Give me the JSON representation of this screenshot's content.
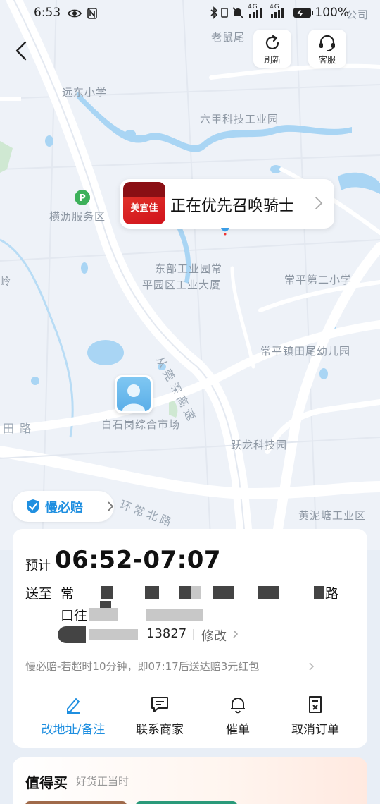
{
  "status_bar": {
    "time": "6:53",
    "battery": "100%",
    "network_1": "4G",
    "network_2": "4G"
  },
  "top_controls": {
    "refresh_label": "刷新",
    "service_label": "客服"
  },
  "map": {
    "labels": [
      "老鼠尾",
      "远东小学",
      "六甲科技工业园",
      "横沥服务区",
      "东部工业园常",
      "平园区工业大厦",
      "常平第二小学",
      "常平镇田尾幼儿园",
      "从莞深高速",
      "田路",
      "白石岗综合市场",
      "跃龙科技园",
      "环常北路",
      "黄泥塘工业区",
      "岭",
      "公司"
    ]
  },
  "rider_bubble": {
    "brand": "美宜佳",
    "status_text": "正在优先召唤骑士"
  },
  "guarantee_chip": {
    "label": "慢必赔"
  },
  "order_card": {
    "eta_prefix": "预计",
    "eta_time": "06:52-07:07",
    "to_label": "送至",
    "address_line1_start": "常",
    "address_line1_end": "路",
    "address_line2_start": "口往",
    "phone_tail": "13827",
    "edit_label": "修改",
    "guarantee_note": "慢必赔-若超时10分钟，即07:17后送达赔3元红包",
    "actions": [
      {
        "label": "改地址/备注",
        "icon": "pencil-icon",
        "active": true
      },
      {
        "label": "联系商家",
        "icon": "message-icon",
        "active": false
      },
      {
        "label": "催单",
        "icon": "bell-icon",
        "active": false
      },
      {
        "label": "取消订单",
        "icon": "cancel-order-icon",
        "active": false
      }
    ]
  },
  "recommend": {
    "title": "值得买",
    "subtitle": "好货正当时"
  },
  "colors": {
    "accent": "#1f8fe0",
    "map_bg": "#eef2f8",
    "road": "#ffffff",
    "water": "#9fd0f2",
    "brand_red": "#d0121b"
  }
}
